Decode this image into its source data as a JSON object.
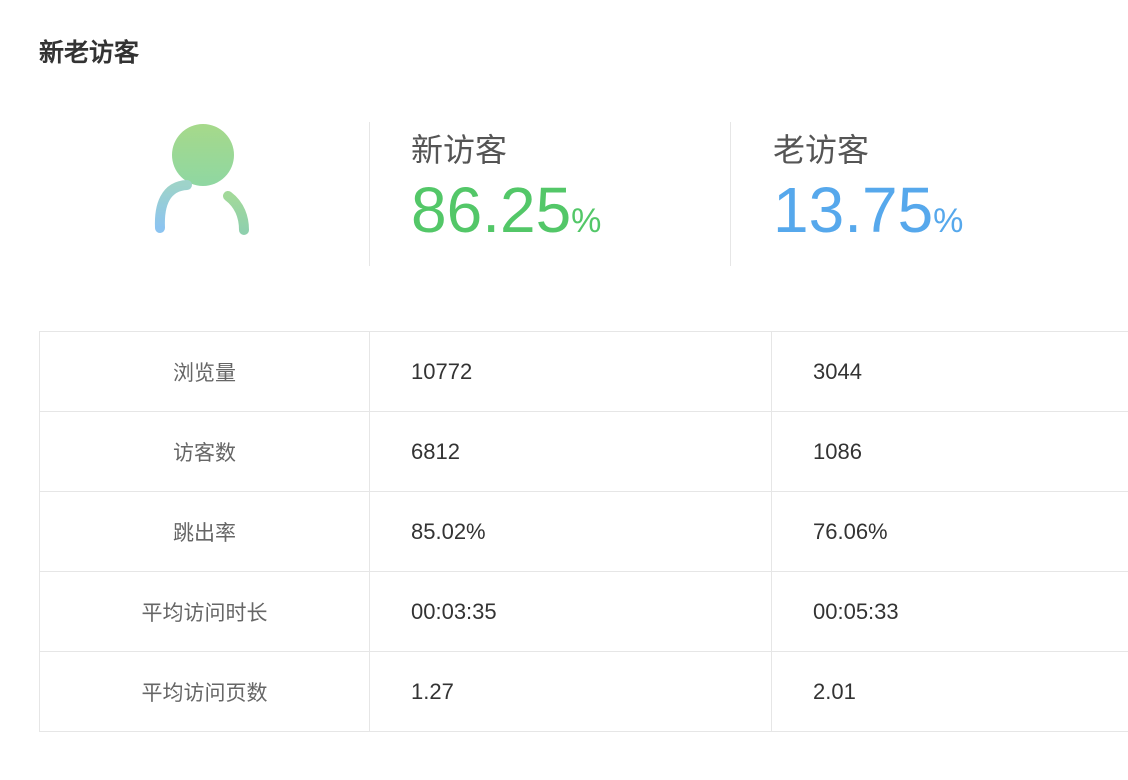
{
  "title": "新老访客",
  "summary": {
    "new_visitor": {
      "label": "新访客",
      "value": "86.25",
      "unit": "%",
      "color": "#53c768"
    },
    "returning_visitor": {
      "label": "老访客",
      "value": "13.75",
      "unit": "%",
      "color": "#56a8ec"
    },
    "avatar_icon": "user-avatar-icon"
  },
  "table": {
    "rows": [
      {
        "name": "浏览量",
        "new": "10772",
        "old": "3044"
      },
      {
        "name": "访客数",
        "new": "6812",
        "old": "1086"
      },
      {
        "name": "跳出率",
        "new": "85.02%",
        "old": "76.06%"
      },
      {
        "name": "平均访问时长",
        "new": "00:03:35",
        "old": "00:05:33"
      },
      {
        "name": "平均访问页数",
        "new": "1.27",
        "old": "2.01"
      }
    ]
  }
}
